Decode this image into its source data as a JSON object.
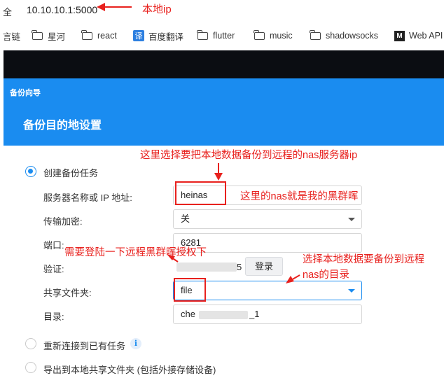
{
  "address_bar": {
    "lock_glyph": "全",
    "url": "10.10.10.1:5000"
  },
  "bookmarks": [
    {
      "label": "言链",
      "icon": "none"
    },
    {
      "label": "星河",
      "icon": "folder-icon"
    },
    {
      "label": "react",
      "icon": "folder-icon"
    },
    {
      "label": "百度翻译",
      "icon": "fanyi-icon",
      "icon_glyph": "译"
    },
    {
      "label": "flutter",
      "icon": "folder-icon"
    },
    {
      "label": "music",
      "icon": "folder-icon"
    },
    {
      "label": "shadowsocks",
      "icon": "folder-icon"
    },
    {
      "label": "Web API",
      "icon": "webapi-icon",
      "icon_glyph": "M"
    }
  ],
  "wizard": {
    "small_title": "备份向导",
    "title": "备份目的地设置"
  },
  "options": {
    "create_task": "创建备份任务",
    "reconnect": "重新连接到已有任务",
    "export_local": "导出到本地共享文件夹 (包括外接存储设备)"
  },
  "form": {
    "server_label": "服务器名称或 IP 地址:",
    "server_value": "heinas",
    "encryption_label": "传输加密:",
    "encryption_value": "关",
    "port_label": "端口:",
    "port_value": "6281",
    "auth_label": "验证:",
    "auth_value_suffix": "5",
    "login_button": "登录",
    "shared_folder_label": "共享文件夹:",
    "shared_folder_value": "file",
    "directory_label": "目录:",
    "directory_prefix": "che",
    "directory_suffix": "_1"
  },
  "annotations": {
    "local_ip": "本地ip",
    "select_remote": "这里选择要把本地数据备份到远程的nas服务器ip",
    "nas_is_mine": "这里的nas就是我的黑群晖",
    "login_note": "需要登陆一下远程黑群晖授权下",
    "select_dir_1": "选择本地数据要备份到远程",
    "select_dir_2": "nas的目录"
  },
  "colors": {
    "accent_blue": "#1a8cf0",
    "annotation_red": "#e8211e",
    "dark_band": "#0b0d12"
  }
}
